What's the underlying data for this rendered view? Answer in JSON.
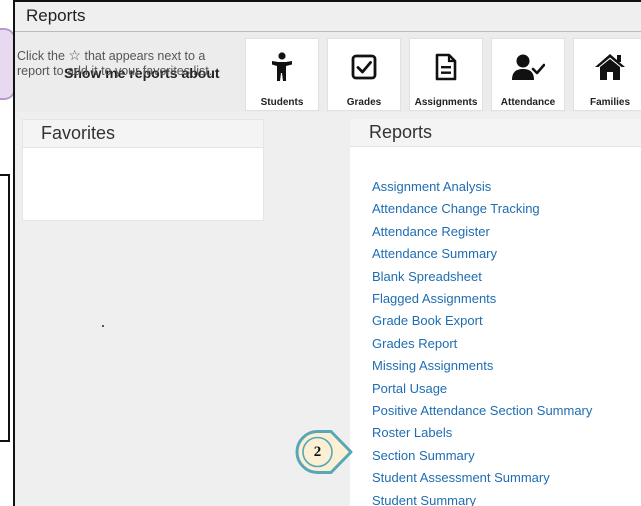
{
  "window": {
    "title": "Reports"
  },
  "filter": {
    "label": "Show me reports about",
    "categories": [
      {
        "label": "Students",
        "icon": "student-icon"
      },
      {
        "label": "Grades",
        "icon": "checkbox-icon"
      },
      {
        "label": "Assignments",
        "icon": "document-icon"
      },
      {
        "label": "Attendance",
        "icon": "user-check-icon"
      },
      {
        "label": "Families",
        "icon": "home-icon"
      }
    ]
  },
  "favorites": {
    "title": "Favorites",
    "help_before": "Click the",
    "help_after": "that appears next to a report to add it to your favorites list."
  },
  "reports": {
    "title": "Reports",
    "items": [
      "Assignment Analysis",
      "Attendance Change Tracking",
      "Attendance Register",
      "Attendance Summary",
      "Blank Spreadsheet",
      "Flagged Assignments",
      "Grade Book Export",
      "Grades Report",
      "Missing Assignments",
      "Portal Usage",
      "Positive Attendance Section Summary",
      "Roster Labels",
      "Section Summary",
      "Student Assessment Summary",
      "Student Summary"
    ]
  },
  "step_badge": {
    "number": "2"
  },
  "colors": {
    "link": "#1e6db3",
    "badge_fill": "#fbf0d4",
    "badge_border": "#58a7b8",
    "callout": "#e8d9f1"
  }
}
